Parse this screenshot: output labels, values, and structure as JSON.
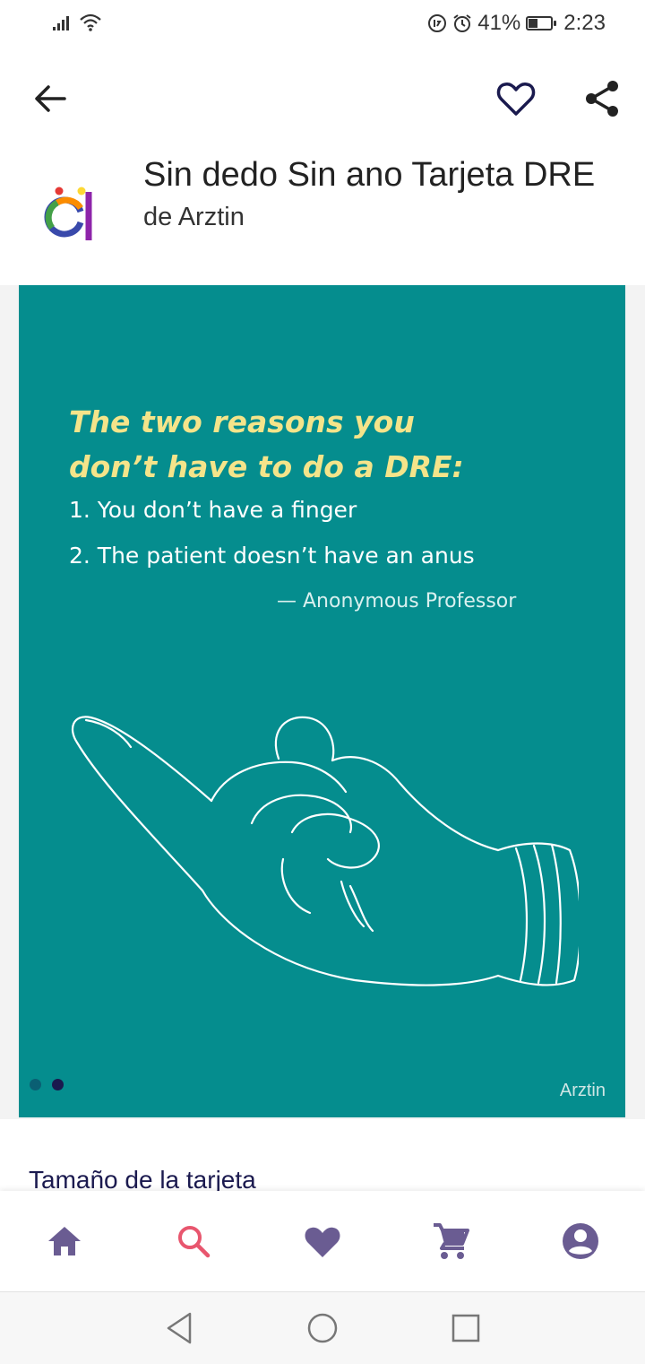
{
  "status_bar": {
    "battery_percent": "41%",
    "battery_level": 0.41,
    "time": "2:23",
    "icons": [
      "signal-icon",
      "wifi-icon",
      "data-saver-icon",
      "alarm-icon",
      "battery-icon"
    ]
  },
  "top_bar": {
    "icons": [
      "arrow-back-icon",
      "heart-outline-icon",
      "share-icon"
    ]
  },
  "product": {
    "title": "Sin dedo Sin ano Tarjeta DRE",
    "artist": "de Arztin"
  },
  "card_image": {
    "heading_line1": "The two reasons you",
    "heading_line2": "don’t have to do a DRE:",
    "line1": "1. You don’t have a finger",
    "line2": "2. The patient doesn’t have an anus",
    "attribution": "— Anonymous Professor",
    "watermark": "Arztin",
    "background_color": "#058d8e",
    "heading_color": "#f4e48a"
  },
  "carousel": {
    "page_count": 2,
    "active_index": 1
  },
  "details": {
    "section_label": "Tamaño de la tarjeta"
  },
  "bottom_nav": {
    "items": [
      "home-icon",
      "search-icon",
      "favorites-icon",
      "cart-icon",
      "account-icon"
    ],
    "active": "search-icon",
    "icon_color": "#6a5c92",
    "active_color": "#e8566e"
  },
  "system_nav": {
    "icons": [
      "back-triangle-icon",
      "home-circle-icon",
      "recents-square-icon"
    ]
  }
}
